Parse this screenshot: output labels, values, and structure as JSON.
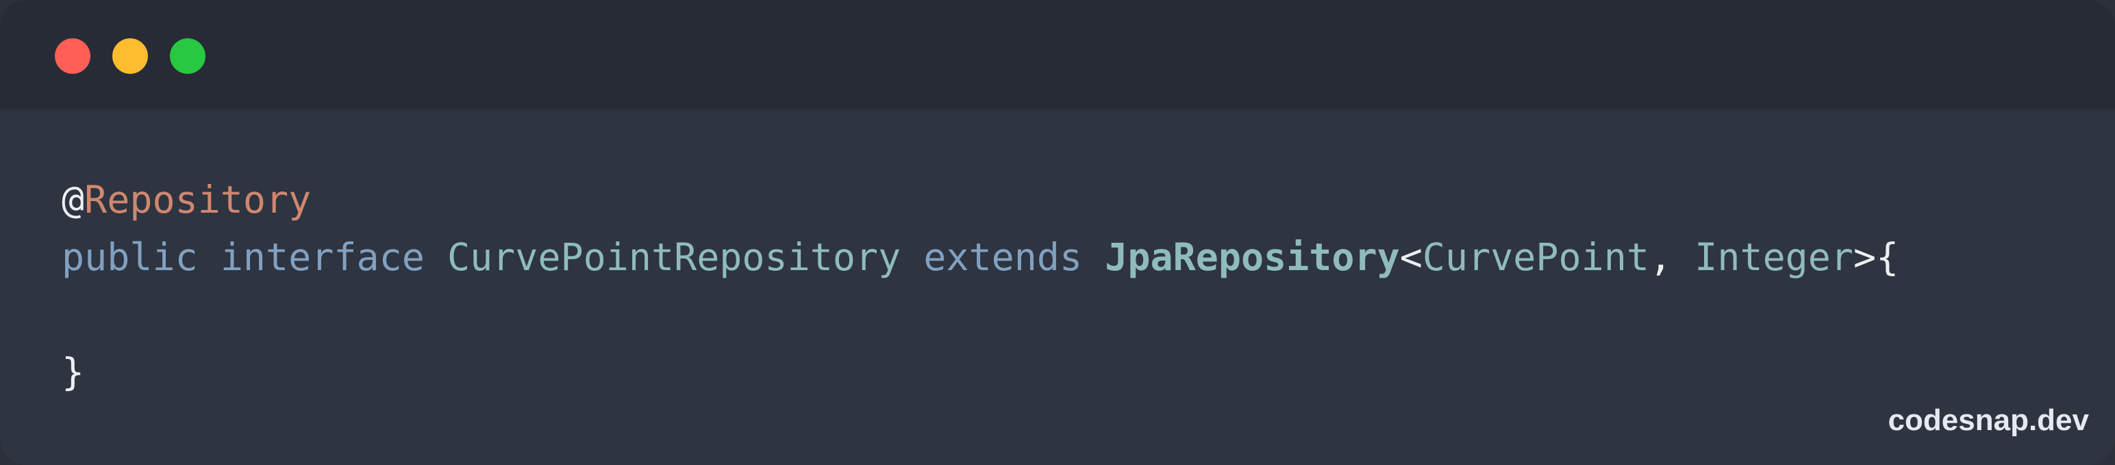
{
  "window": {
    "controls": {
      "close_color": "#ff5f57",
      "minimize_color": "#febc2e",
      "maximize_color": "#28c840"
    }
  },
  "code": {
    "language": "java",
    "lines": [
      [
        {
          "text": "@",
          "kind": "at"
        },
        {
          "text": "Repository",
          "kind": "annotation"
        }
      ],
      [
        {
          "text": "public",
          "kind": "keyword"
        },
        {
          "text": " ",
          "kind": "space"
        },
        {
          "text": "interface",
          "kind": "keyword"
        },
        {
          "text": " ",
          "kind": "space"
        },
        {
          "text": "CurvePointRepository",
          "kind": "type"
        },
        {
          "text": " ",
          "kind": "space"
        },
        {
          "text": "extends",
          "kind": "keyword"
        },
        {
          "text": " ",
          "kind": "space"
        },
        {
          "text": "JpaRepository",
          "kind": "type-bold"
        },
        {
          "text": "<",
          "kind": "punct"
        },
        {
          "text": "CurvePoint",
          "kind": "type"
        },
        {
          "text": ", ",
          "kind": "punct"
        },
        {
          "text": "Integer",
          "kind": "type"
        },
        {
          "text": ">{",
          "kind": "punct"
        }
      ],
      [],
      [
        {
          "text": "}",
          "kind": "punct"
        }
      ]
    ]
  },
  "watermark": {
    "text": "codesnap.dev"
  }
}
